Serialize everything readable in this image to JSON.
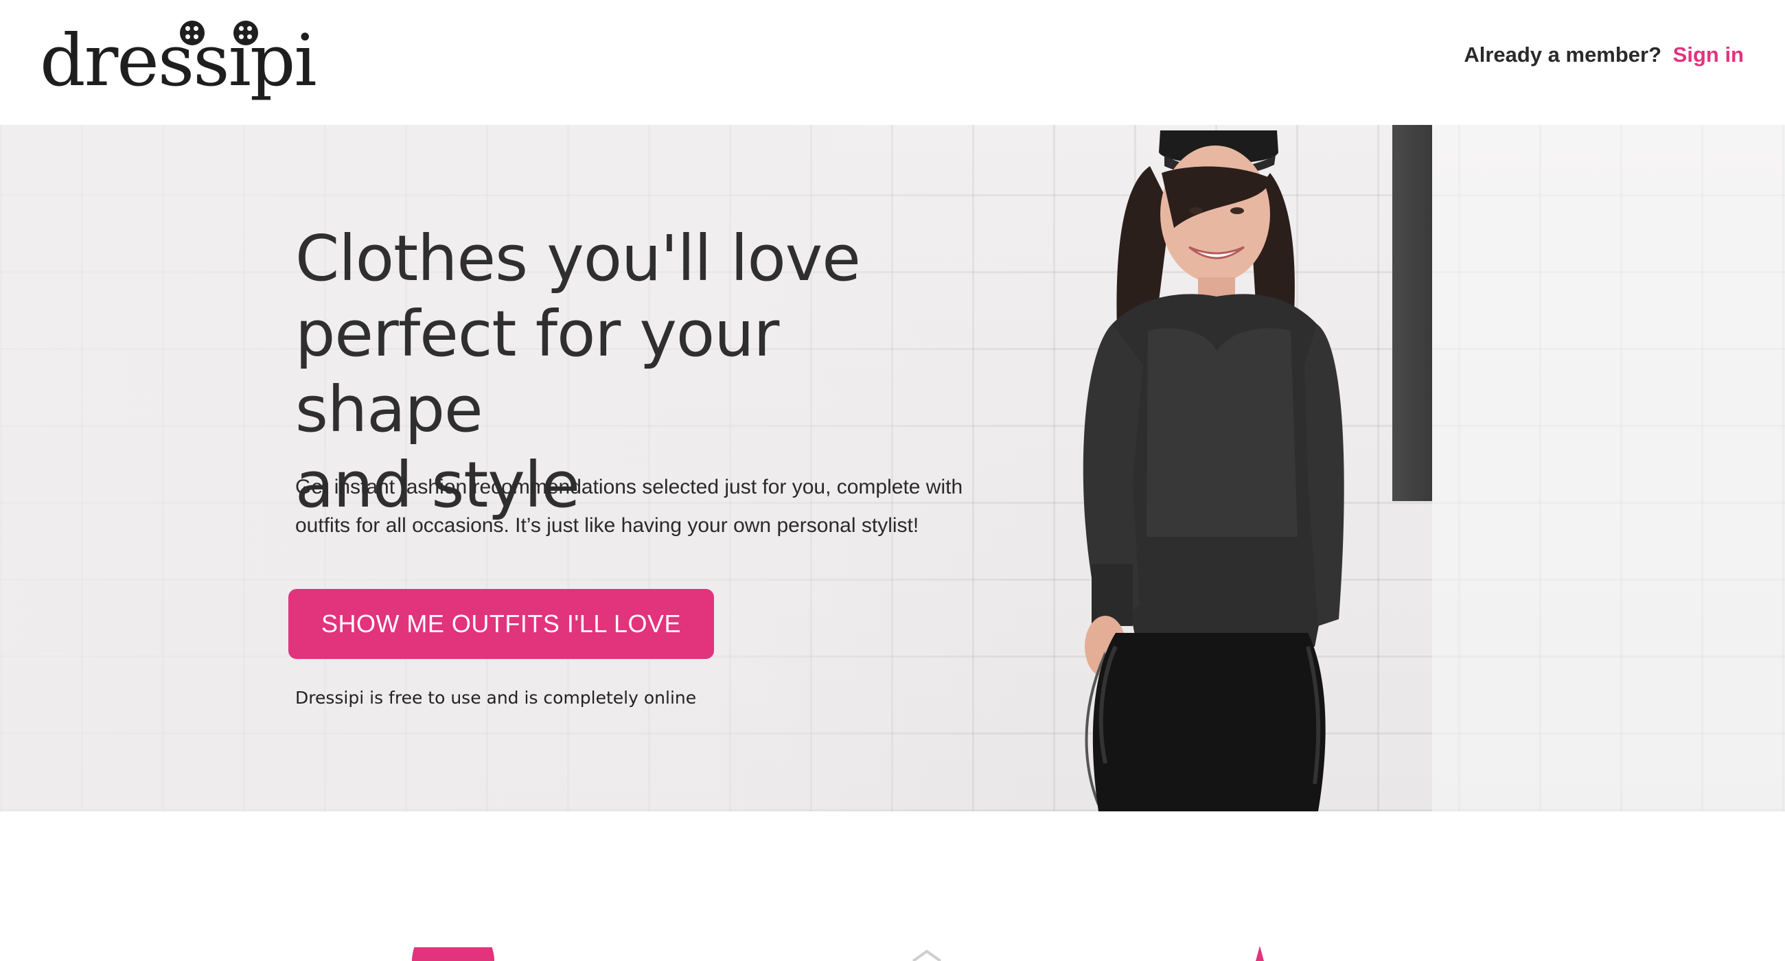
{
  "header": {
    "logo_text": "dressipi",
    "member_prompt": "Already a member?",
    "sign_in_label": "Sign in"
  },
  "hero": {
    "headline_line1": "Clothes you'll love",
    "headline_line2": "perfect for your shape",
    "headline_line3": "and style",
    "subtext_line1": "Get instant fashion recommendations selected just for you, complete with",
    "subtext_line2": "outfits for all occasions. It’s just like having your own personal stylist!",
    "cta_label": "SHOW ME OUTFITS I'LL LOVE",
    "free_note": "Dressipi is free to use and is completely online",
    "image_icon": "woman-photo"
  },
  "colors": {
    "accent": "#e2337d",
    "text_dark": "#2f2f2f",
    "hero_bg": "#eceaea"
  },
  "features": {
    "icons": [
      "pink-circle-icon",
      "hanger-icon",
      "star-icon"
    ]
  }
}
